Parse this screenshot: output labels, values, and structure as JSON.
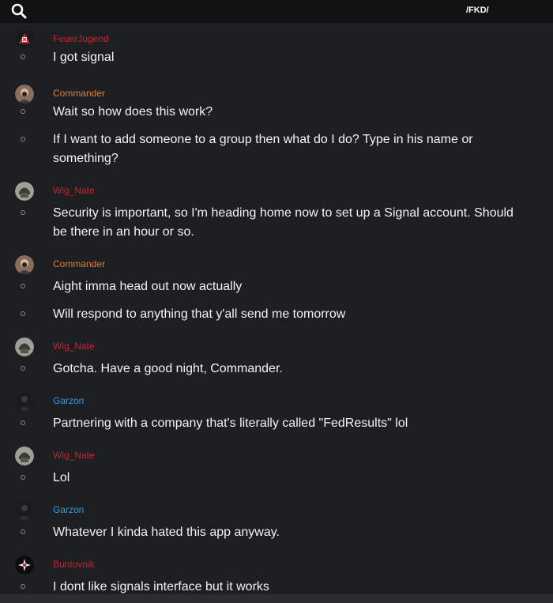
{
  "header": {
    "channel_title": "/FKD/",
    "search_icon": "search-icon"
  },
  "colors": {
    "red_user": "#c0262b",
    "orange_user": "#d8822b",
    "blue_user": "#3b97d3"
  },
  "messages": [
    {
      "username": "FeuerJugend",
      "name_color": "#c0262b",
      "avatar": "red-emblem-avatar",
      "lines": [
        "I got signal"
      ]
    },
    {
      "username": "Commander",
      "name_color": "#d8822b",
      "avatar": "portrait-avatar",
      "lines": [
        "Wait so how does this work?",
        "If I want to add someone to a group then what do I do? Type in his name or something?"
      ]
    },
    {
      "username": "Wig_Nate",
      "name_color": "#c0262b",
      "avatar": "helmet-avatar",
      "lines": [
        "Security is important, so I'm heading home now to set up a Signal account. Should be there in an hour or so."
      ]
    },
    {
      "username": "Commander",
      "name_color": "#d8822b",
      "avatar": "portrait-avatar",
      "lines": [
        "Aight imma head out now actually",
        "Will respond to anything that y'all send me tomorrow"
      ]
    },
    {
      "username": "Wig_Nate",
      "name_color": "#c0262b",
      "avatar": "helmet-avatar",
      "lines": [
        "Gotcha. Have a good night, Commander."
      ]
    },
    {
      "username": "Garzon",
      "name_color": "#3b97d3",
      "avatar": "dark-figure-avatar",
      "lines": [
        "Partnering with a company that's literally called \"FedResults\" lol"
      ]
    },
    {
      "username": "Wig_Nate",
      "name_color": "#c0262b",
      "avatar": "helmet-avatar",
      "lines": [
        "Lol"
      ]
    },
    {
      "username": "Garzon",
      "name_color": "#3b97d3",
      "avatar": "dark-figure-avatar",
      "lines": [
        "Whatever I kinda hated this app anyway."
      ]
    },
    {
      "username": "Buntovnik",
      "name_color": "#c0262b",
      "avatar": "starburst-avatar",
      "lines": [
        "I dont like signals interface but it works"
      ]
    }
  ]
}
